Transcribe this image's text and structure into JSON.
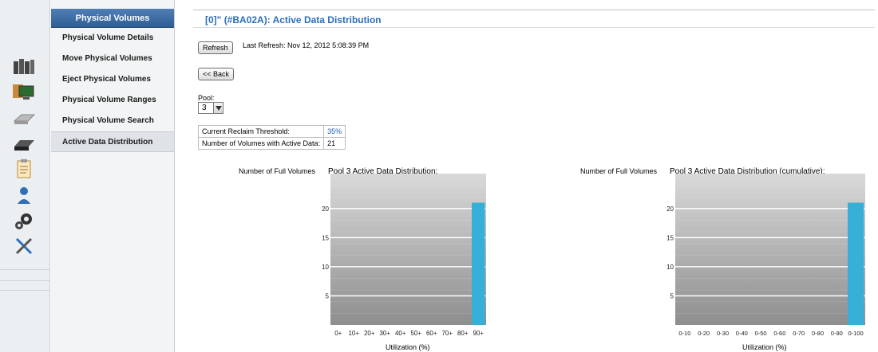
{
  "rail": {
    "icons": [
      "servers-icon",
      "monitor-icon",
      "drive-icon",
      "tape-drive-icon",
      "clipboard-icon",
      "user-icon",
      "gears-icon",
      "tools-icon"
    ]
  },
  "nav": {
    "header": "Physical Volumes",
    "items": [
      {
        "label": "Physical Volume Details"
      },
      {
        "label": "Move Physical Volumes"
      },
      {
        "label": "Eject Physical Volumes"
      },
      {
        "label": "Physical Volume Ranges"
      },
      {
        "label": "Physical Volume Search"
      },
      {
        "label": "Active Data Distribution",
        "active": true
      }
    ]
  },
  "page": {
    "title": "[0]\" (#BA02A): Active Data Distribution",
    "refresh_label": "Refresh",
    "last_refresh": "Last Refresh:  Nov 12, 2012 5:08:39 PM",
    "back_label": "<< Back",
    "pool_label": "Pool:",
    "pool_value": "3"
  },
  "info": {
    "reclaim_label": "Current Reclaim Threshold:",
    "reclaim_value": "35%",
    "volumes_label": "Number of Volumes with Active Data:",
    "volumes_value": "21"
  },
  "colors": {
    "accent": "#2a6ebb",
    "bar": "#36b0d6"
  },
  "chart_data": [
    {
      "type": "bar",
      "title": "Pool 3 Active Data Distribution:",
      "ylabel": "Number of Full Volumes",
      "xlabel": "Utilization (%)",
      "categories": [
        "0+",
        "10+",
        "20+",
        "30+",
        "40+",
        "50+",
        "60+",
        "70+",
        "80+",
        "90+"
      ],
      "values": [
        0,
        0,
        0,
        0,
        0,
        0,
        0,
        0,
        0,
        21
      ],
      "yticks": [
        5,
        10,
        15,
        20
      ],
      "ylim": [
        0,
        26
      ],
      "grid": true
    },
    {
      "type": "bar",
      "title": "Pool 3 Active Data Distribution (cumulative):",
      "ylabel": "Number of Full Volumes",
      "xlabel": "Utilization (%)",
      "categories": [
        "0-10",
        "0-20",
        "0-30",
        "0-40",
        "0-50",
        "0-60",
        "0-70",
        "0-80",
        "0-90",
        "0-100"
      ],
      "values": [
        0,
        0,
        0,
        0,
        0,
        0,
        0,
        0,
        0,
        21
      ],
      "yticks": [
        5,
        10,
        15,
        20
      ],
      "ylim": [
        0,
        26
      ],
      "grid": true
    }
  ]
}
